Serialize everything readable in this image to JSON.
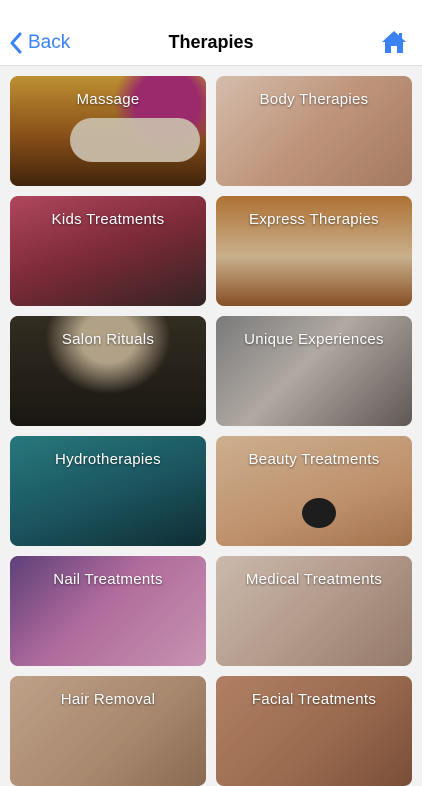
{
  "nav": {
    "back_label": "Back",
    "title": "Therapies",
    "home_icon": "home-icon",
    "back_icon": "chevron-left-icon",
    "accent_color": "#3b82f6"
  },
  "tiles": [
    {
      "label": "Massage"
    },
    {
      "label": "Body Therapies"
    },
    {
      "label": "Kids Treatments"
    },
    {
      "label": "Express Therapies"
    },
    {
      "label": "Salon Rituals"
    },
    {
      "label": "Unique Experiences"
    },
    {
      "label": "Hydrotherapies"
    },
    {
      "label": "Beauty Treatments"
    },
    {
      "label": "Nail Treatments"
    },
    {
      "label": "Medical Treatments"
    },
    {
      "label": "Hair Removal"
    },
    {
      "label": "Facial Treatments"
    }
  ]
}
